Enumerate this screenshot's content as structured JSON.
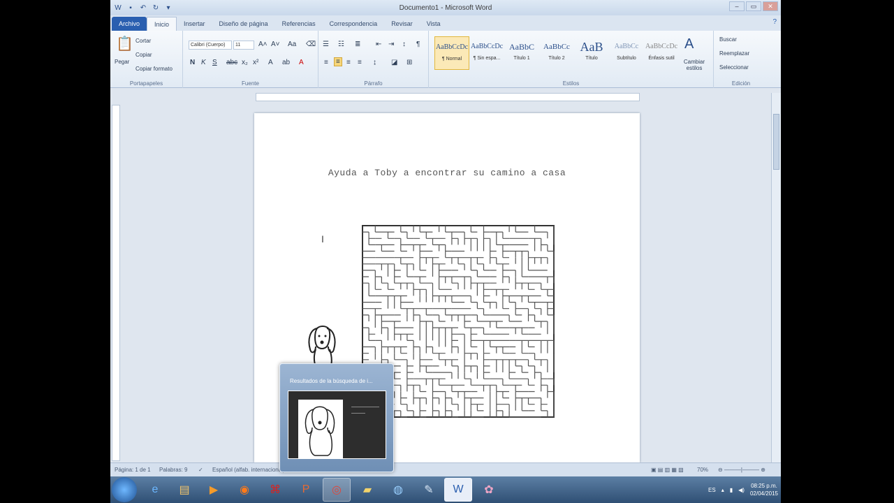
{
  "window": {
    "title": "Documento1 - Microsoft Word",
    "controls": [
      "–",
      "▭",
      "✕"
    ]
  },
  "tabs": [
    "Archivo",
    "Inicio",
    "Insertar",
    "Diseño de página",
    "Referencias",
    "Correspondencia",
    "Revisar",
    "Vista"
  ],
  "ribbon": {
    "clipboard": {
      "paste": "Pegar",
      "cut": "Cortar",
      "copy": "Copiar",
      "format_painter": "Copiar formato",
      "label": "Portapapeles"
    },
    "font": {
      "font_name": "Calibri (Cuerpo)",
      "font_size": "11",
      "label": "Fuente"
    },
    "paragraph": {
      "label": "Párrafo"
    },
    "styles": {
      "items": [
        {
          "sample": "AaBbCcDc",
          "name": "¶ Normal"
        },
        {
          "sample": "AaBbCcDc",
          "name": "¶ Sin espa..."
        },
        {
          "sample": "AaBbC",
          "name": "Título 1"
        },
        {
          "sample": "AaBbCc",
          "name": "Título 2"
        },
        {
          "sample": "AaB",
          "name": "Título"
        },
        {
          "sample": "AaBbCc",
          "name": "Subtítulo"
        },
        {
          "sample": "AaBbCcDc",
          "name": "Énfasis sutil"
        }
      ],
      "change_styles": "Cambiar estilos",
      "label": "Estilos"
    },
    "editing": {
      "find": "Buscar",
      "replace": "Reemplazar",
      "select": "Seleccionar",
      "label": "Edición"
    }
  },
  "document": {
    "heading": "Ayuda a Toby a encontrar su camino a casa"
  },
  "thumbnail": {
    "title": "Resultados de la búsqueda de i..."
  },
  "statusbar": {
    "page": "Página: 1 de 1",
    "words": "Palabras: 9",
    "language": "Español (alfab. internacional)",
    "zoom": "70%"
  },
  "taskbar": {
    "time": "08:25 p.m.",
    "date": "02/04/2015",
    "lang": "ES"
  }
}
